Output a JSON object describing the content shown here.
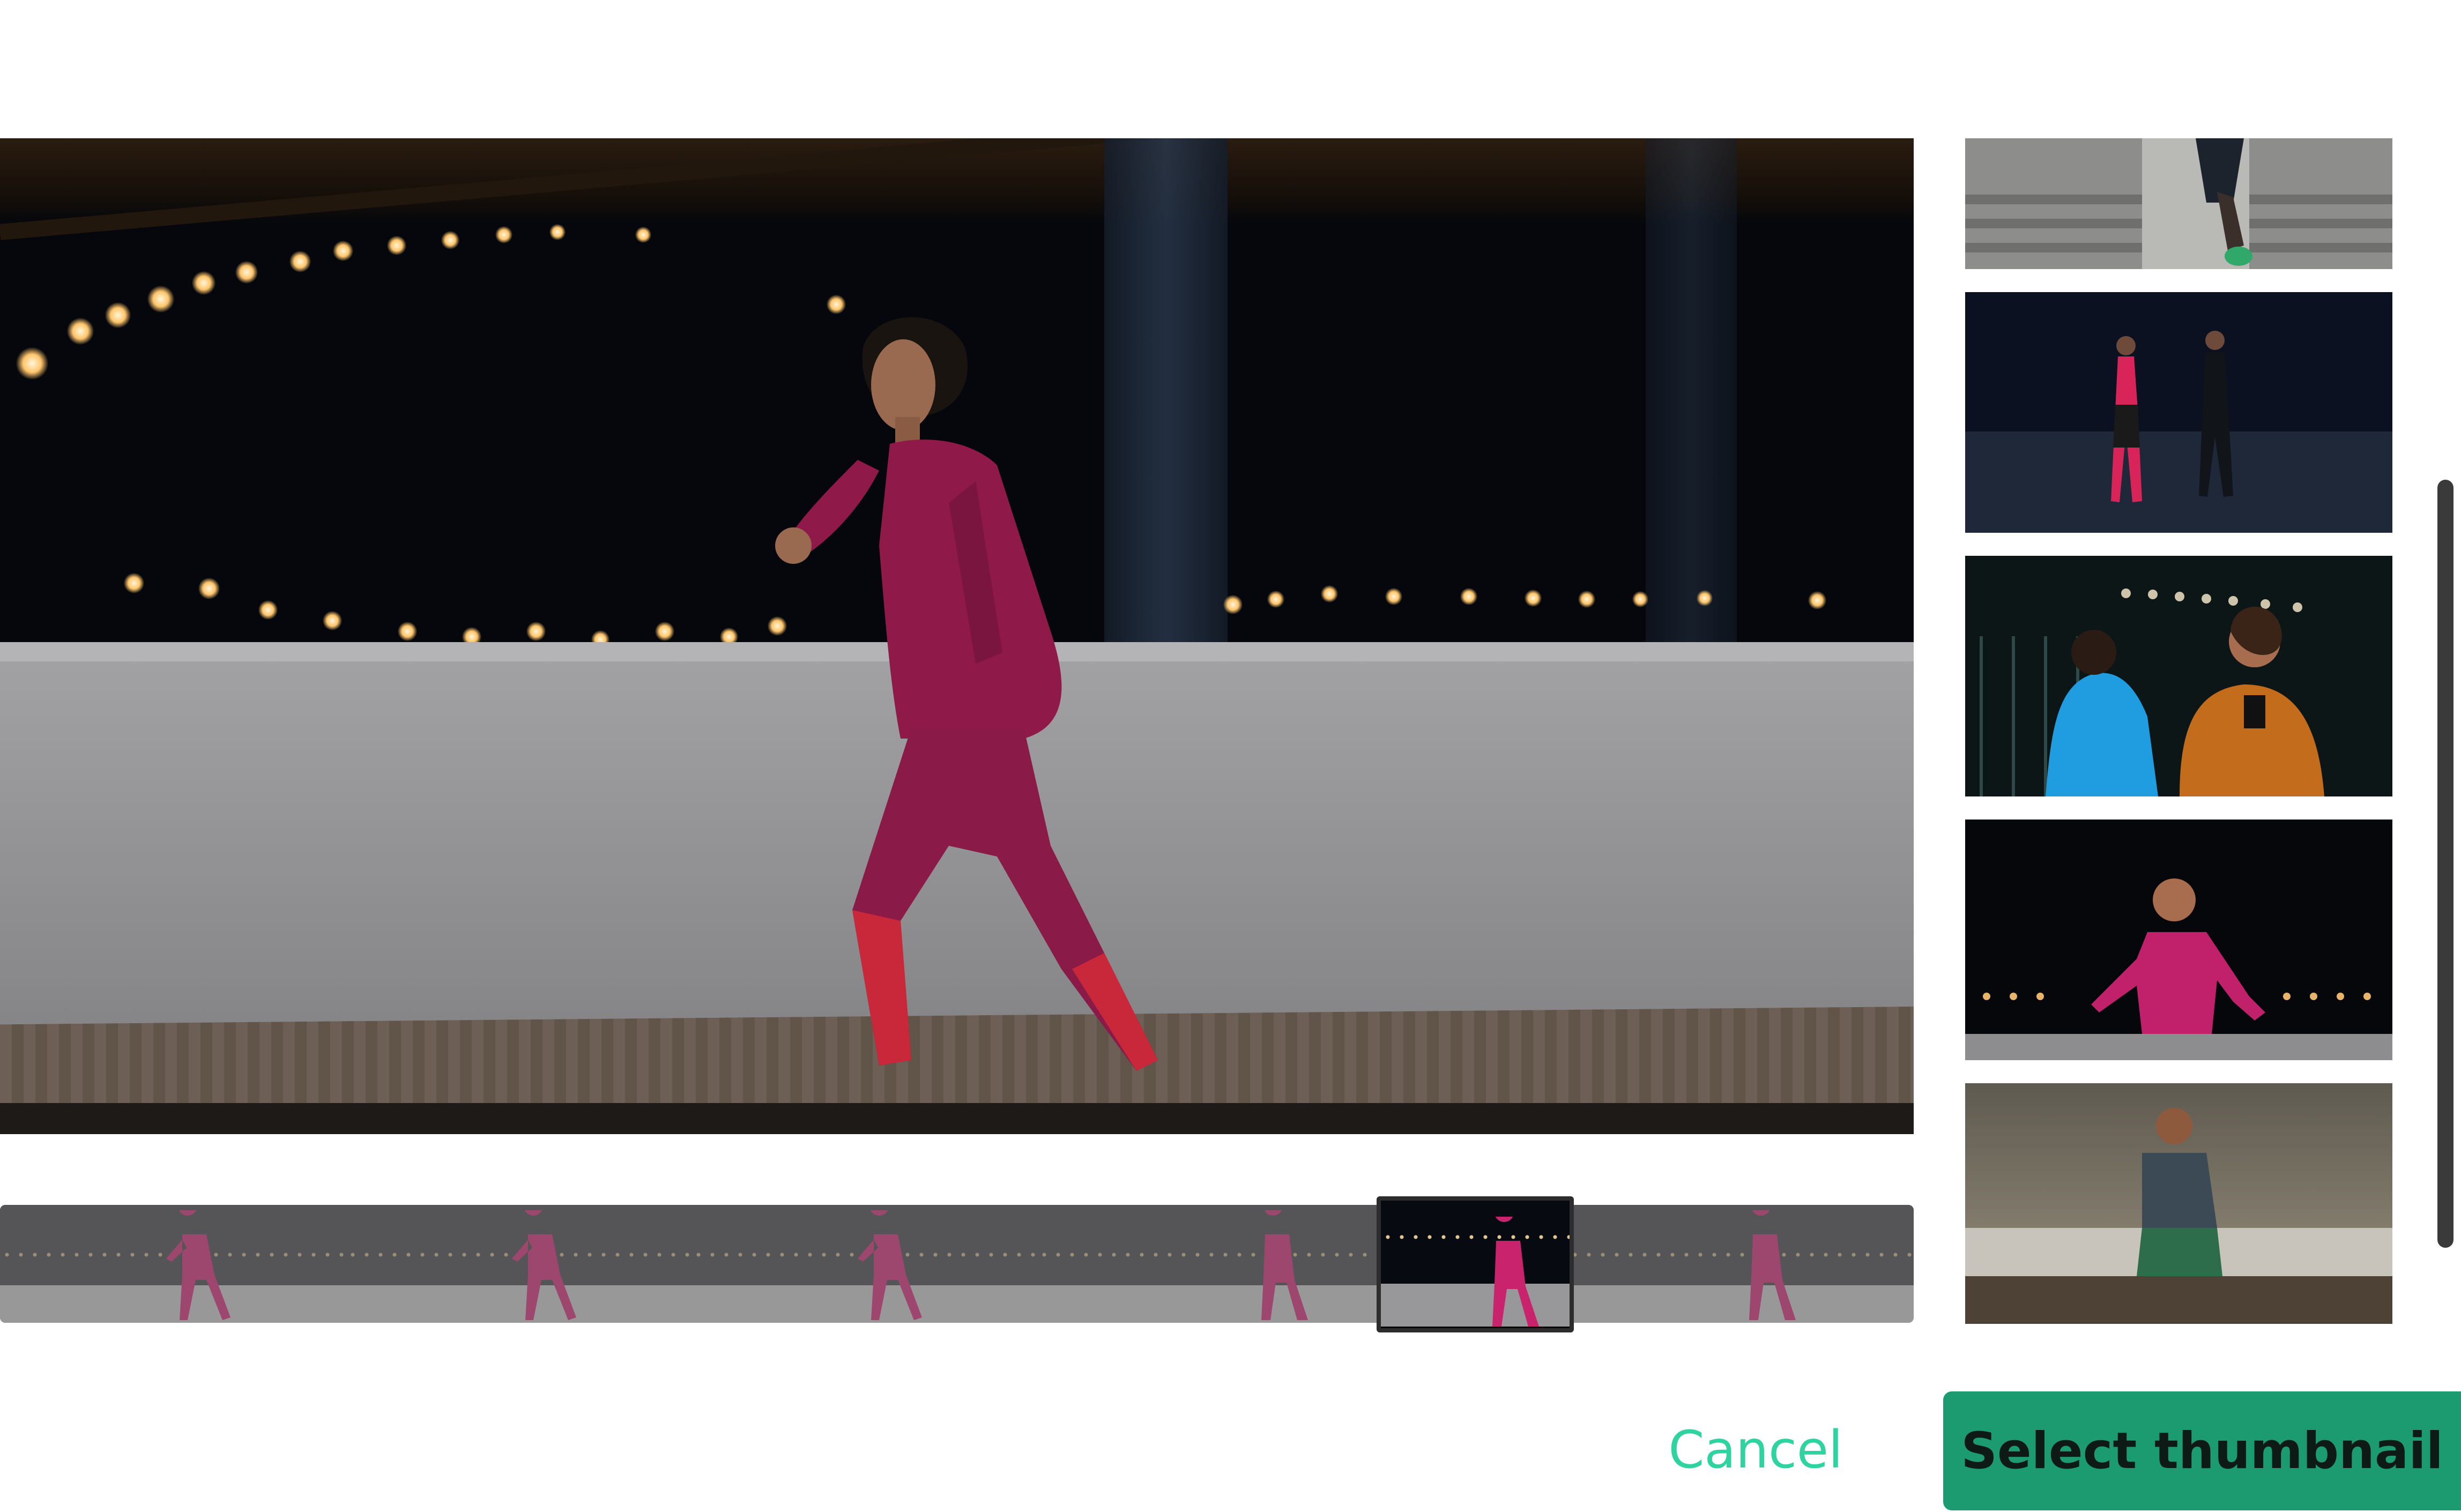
{
  "colors": {
    "accent": "#1c9a70",
    "cancel_text": "#2fd3a0",
    "selected_frame_border": "#2d2d2d",
    "scrollbar": "#3a3a3a"
  },
  "preview": {
    "image": "woman-running-at-night-photo"
  },
  "filmstrip": {
    "frame_count": 6,
    "selected_frame": 5
  },
  "thumbnails": [
    {
      "image": "runner-on-stairs-photo"
    },
    {
      "image": "two-runners-at-night-photo"
    },
    {
      "image": "woman-checking-phone-photo"
    },
    {
      "image": "woman-running-at-night-photo"
    },
    {
      "image": "man-running-at-dusk-photo"
    }
  ],
  "footer": {
    "cancel_label": "Cancel",
    "select_label": "Select thumbnail"
  }
}
